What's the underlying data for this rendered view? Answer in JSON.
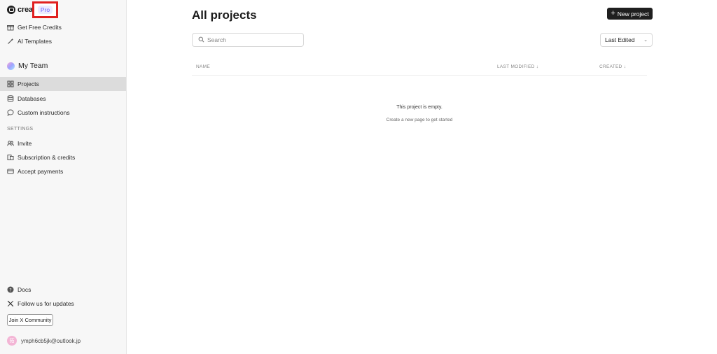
{
  "brand": {
    "name": "creat",
    "badge": "Pro"
  },
  "sidebar": {
    "top_items": [
      {
        "label": "Get Free Credits",
        "icon": "gift-icon"
      },
      {
        "label": "AI Templates",
        "icon": "wand-icon"
      }
    ],
    "team": {
      "label": "My Team"
    },
    "team_items": [
      {
        "label": "Projects",
        "icon": "grid-icon",
        "active": true
      },
      {
        "label": "Databases",
        "icon": "database-icon"
      },
      {
        "label": "Custom instructions",
        "icon": "chat-icon"
      }
    ],
    "settings_label": "SETTINGS",
    "settings_items": [
      {
        "label": "Invite",
        "icon": "users-icon"
      },
      {
        "label": "Subscription & credits",
        "icon": "coins-icon"
      },
      {
        "label": "Accept payments",
        "icon": "card-icon"
      }
    ],
    "bottom_items": [
      {
        "label": "Docs",
        "icon": "help-icon"
      },
      {
        "label": "Follow us for updates",
        "icon": "x-logo-icon"
      }
    ],
    "join_label": "Join X Community",
    "user": {
      "email": "ymph6cb5jk@outlook.jp",
      "avatar_glyph": "拓"
    }
  },
  "main": {
    "title": "All projects",
    "new_button": "New project",
    "search_placeholder": "Search",
    "sort": "Last Edited",
    "columns": {
      "name": "NAME",
      "modified": "LAST MODIFIED ↓",
      "created": "CREATED ↓"
    },
    "empty_title": "This project is empty.",
    "empty_subtitle": "Create a new page to get started"
  }
}
